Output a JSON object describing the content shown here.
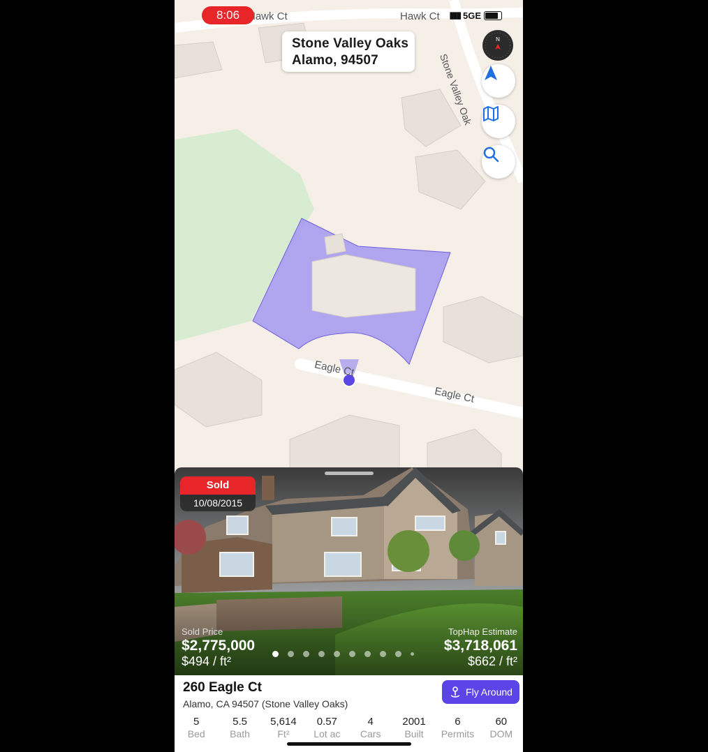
{
  "status": {
    "time": "8:06",
    "network": "5GE"
  },
  "map": {
    "callout": {
      "line1": "Stone Valley Oaks",
      "line2": "Alamo, 94507"
    },
    "roads": {
      "top": "Hawk Ct",
      "top_right": "Hawk Ct",
      "diag": "Stone Valley Oak",
      "eagle_1": "Eagle Ct",
      "eagle_2": "Eagle Ct"
    },
    "parcel_color": "#a99cf0",
    "buttons": [
      "compass-icon",
      "location-arrow-icon",
      "map-icon",
      "search-icon"
    ]
  },
  "listing": {
    "badge": "Sold",
    "date": "10/08/2015",
    "sold_label": "Sold Price",
    "sold_price": "$2,775,000",
    "sold_ppsf": "$494 / ft²",
    "estimate_label": "TopHap Estimate",
    "estimate_price": "$3,718,061",
    "estimate_ppsf": "$662 / ft²",
    "address": "260 Eagle Ct",
    "subaddress": "Alamo, CA 94507 (Stone Valley Oaks)",
    "fly_label": "Fly Around",
    "stats": [
      {
        "value": "5",
        "label": "Bed"
      },
      {
        "value": "5.5",
        "label": "Bath"
      },
      {
        "value": "5,614",
        "label": "Ft²"
      },
      {
        "value": "0.57",
        "label": "Lot ac"
      },
      {
        "value": "4",
        "label": "Cars"
      },
      {
        "value": "2001",
        "label": "Built"
      },
      {
        "value": "6",
        "label": "Permits"
      },
      {
        "value": "60",
        "label": "DOM"
      }
    ],
    "photo_index": 1,
    "photo_count": 10
  }
}
